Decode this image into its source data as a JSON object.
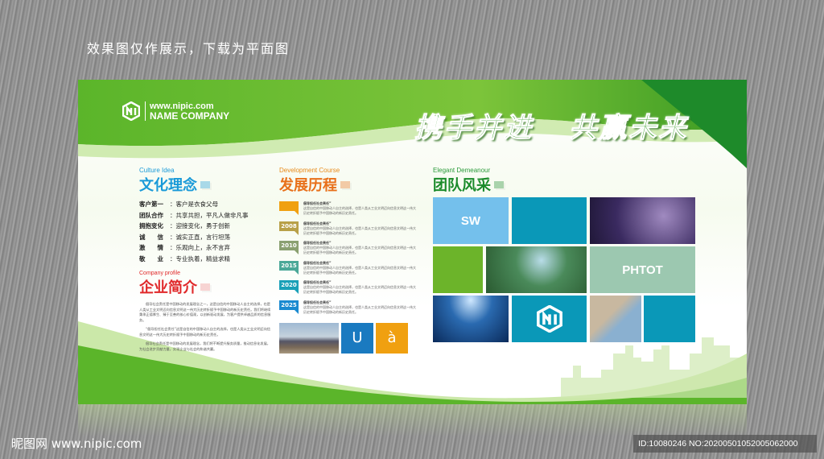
{
  "notice": "效果图仅作展示，下载为平面图",
  "logo": {
    "url": "www.nipic.com",
    "name": "NAME COMPANY"
  },
  "slogan": "携手并进   共赢未来",
  "culture": {
    "en": "Culture Idea",
    "cn": "文化理念",
    "items": [
      {
        "k": "客户第一",
        "v": "：客户是衣食父母"
      },
      {
        "k": "团队合作",
        "v": "：共享共担，平凡人做非凡事"
      },
      {
        "k": "拥抱变化",
        "v": "：迎接变化，勇于创新"
      },
      {
        "k": "诚　　信",
        "v": "：诚实正直，言行坦荡"
      },
      {
        "k": "激　　情",
        "v": "：乐观向上，永不言弃"
      },
      {
        "k": "敬　　业",
        "v": "：专业执着，精益求精"
      }
    ]
  },
  "profile": {
    "en": "Company profile",
    "cn": "企业简介",
    "paras": [
      "倡导社会责任是中国移动的发展理念之一，这是自信的中国移动人自主的选择，也是人类从工业文明迈向信息文明这一伟大历史转折赋予中国移动的新历史责任。我们将继续秉承正德厚生、臻于至善的核心价值观，以创新驱动发展，为客户提供卓越品质的信息服务。",
      "“倡导担任社会责任”这是自信的中国移动人自主的选择，也是人类从工业文明迈向信息文明这一伟大历史转折赋予中国移动的新历史责任。",
      "倡导社会责任是中国移动的发展理念，我们将不断提升服务质量，推动信息化发展，为社会进步贡献力量，实现企业与社会的和谐共赢。"
    ]
  },
  "course": {
    "en": "Development Course",
    "cn": "发展历程",
    "items": [
      {
        "year": "",
        "color": "#f0a010"
      },
      {
        "year": "2008",
        "color": "#b8a048"
      },
      {
        "year": "2010",
        "color": "#8aa070"
      },
      {
        "year": "2015",
        "color": "#4aa898"
      },
      {
        "year": "2020",
        "color": "#1aa0b8"
      },
      {
        "year": "2025",
        "color": "#1a8ad0"
      }
    ],
    "item_title": "倡导担任社会责任”",
    "item_text": "这是自信的中国移动人自主的选择，也是人类从工业文明迈向信息文明这一伟大历史转折赋予中国移动的新历史责任。",
    "pic_u": "U",
    "pic_a": "à"
  },
  "team": {
    "en": "Elegant Demeanour",
    "cn": "团队风采",
    "sw": "SW",
    "phtot": "PHTOT"
  },
  "watermark": "昵图网 www.nipic.com",
  "id": "ID:10080246 NO:20200501052005062000"
}
